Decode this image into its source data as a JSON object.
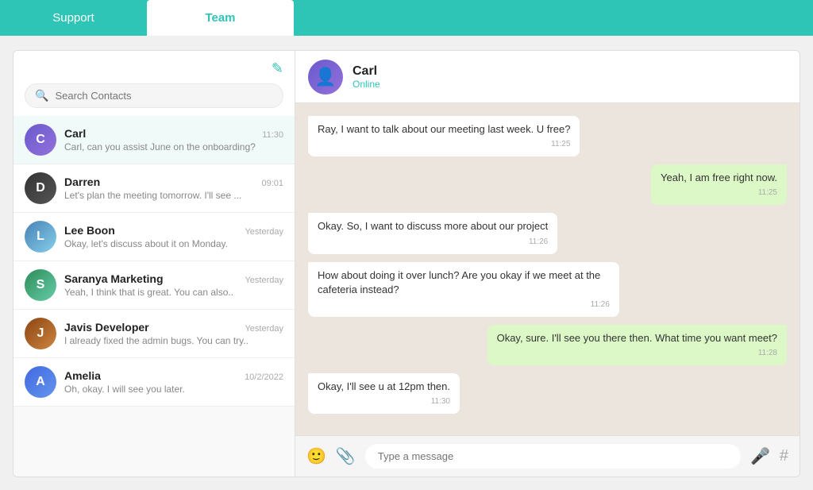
{
  "nav": {
    "tabs": [
      {
        "id": "support",
        "label": "Support",
        "active": false
      },
      {
        "id": "team",
        "label": "Team",
        "active": true
      }
    ]
  },
  "sidebar": {
    "search_placeholder": "Search Contacts",
    "compose_icon": "✎",
    "contacts": [
      {
        "id": "carl",
        "name": "Carl",
        "preview": "Carl, can you assist June on the onboarding?",
        "time": "11:30",
        "avatar_label": "C",
        "avatar_class": "avatar-carl",
        "active": true
      },
      {
        "id": "darren",
        "name": "Darren",
        "preview": "Let's plan the meeting tomorrow. I'll see ...",
        "time": "09:01",
        "avatar_label": "D",
        "avatar_class": "avatar-darren",
        "active": false
      },
      {
        "id": "lee",
        "name": "Lee Boon",
        "preview": "Okay, let's discuss about it on Monday.",
        "time": "Yesterday",
        "avatar_label": "L",
        "avatar_class": "avatar-lee",
        "active": false
      },
      {
        "id": "saranya",
        "name": "Saranya Marketing",
        "preview": "Yeah, I think that is great. You can also..",
        "time": "Yesterday",
        "avatar_label": "S",
        "avatar_class": "avatar-saranya",
        "active": false
      },
      {
        "id": "javis",
        "name": "Javis Developer",
        "preview": "I already fixed the admin bugs. You can try..",
        "time": "Yesterday",
        "avatar_label": "J",
        "avatar_class": "avatar-javis",
        "active": false
      },
      {
        "id": "amelia",
        "name": "Amelia",
        "preview": "Oh, okay. I will see you later.",
        "time": "10/2/2022",
        "avatar_label": "A",
        "avatar_class": "avatar-amelia",
        "active": false
      }
    ]
  },
  "chat": {
    "contact_name": "Carl",
    "contact_status": "Online",
    "messages": [
      {
        "id": 1,
        "type": "received",
        "text": "Ray, I want to talk about our meeting last week. U free?",
        "time": "11:25"
      },
      {
        "id": 2,
        "type": "sent",
        "text": "Yeah, I am free right now.",
        "time": "11:25"
      },
      {
        "id": 3,
        "type": "received",
        "text": "Okay. So, I want to discuss more about our project",
        "time": "11:26"
      },
      {
        "id": 4,
        "type": "received",
        "text": "How about doing it over lunch? Are you okay if we meet at the cafeteria instead?",
        "time": "11:26"
      },
      {
        "id": 5,
        "type": "sent",
        "text": "Okay, sure. I'll see you there then. What time you want meet?",
        "time": "11:28"
      },
      {
        "id": 6,
        "type": "received",
        "text": "Okay, I'll see u at 12pm then.",
        "time": "11:30"
      }
    ],
    "input_placeholder": "Type a message"
  }
}
